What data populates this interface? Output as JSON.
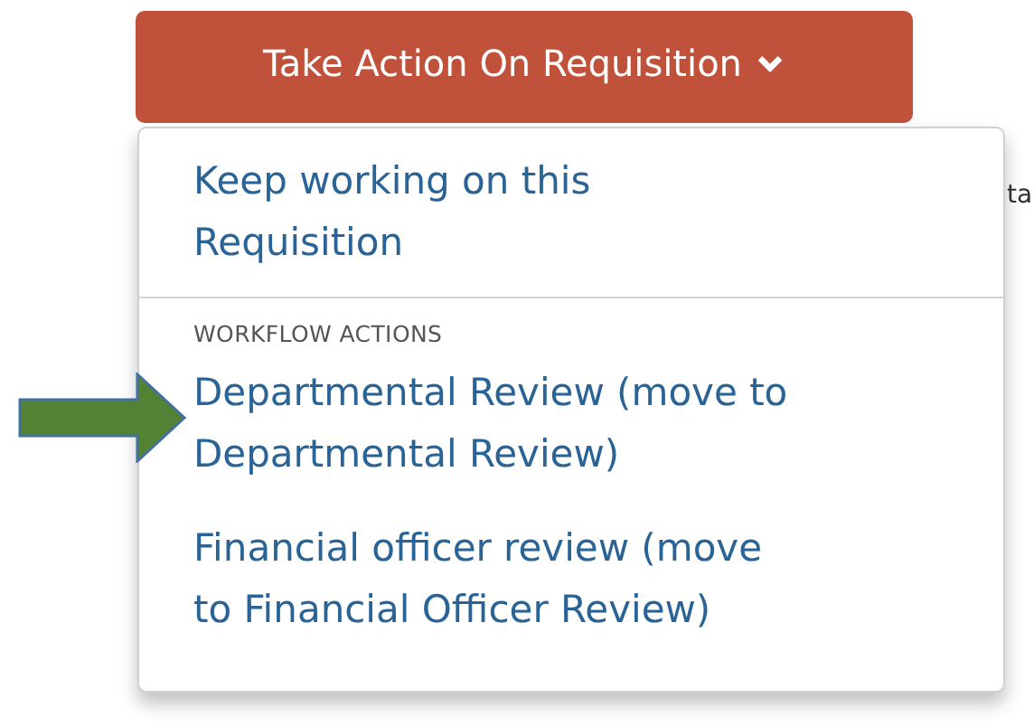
{
  "action_button": {
    "label": "Take Action On Requisition"
  },
  "background_text": "ta",
  "menu": {
    "items": [
      {
        "kind": "link",
        "label": "Keep working on this Requisition"
      },
      {
        "kind": "divider"
      },
      {
        "kind": "header",
        "label": "WORKFLOW ACTIONS"
      },
      {
        "kind": "link",
        "label": "Departmental Review (move to Departmental Review)",
        "pointed": true
      },
      {
        "kind": "link",
        "label": "Financial officer review (move to Financial Officer Review)",
        "pointed": false
      }
    ]
  }
}
